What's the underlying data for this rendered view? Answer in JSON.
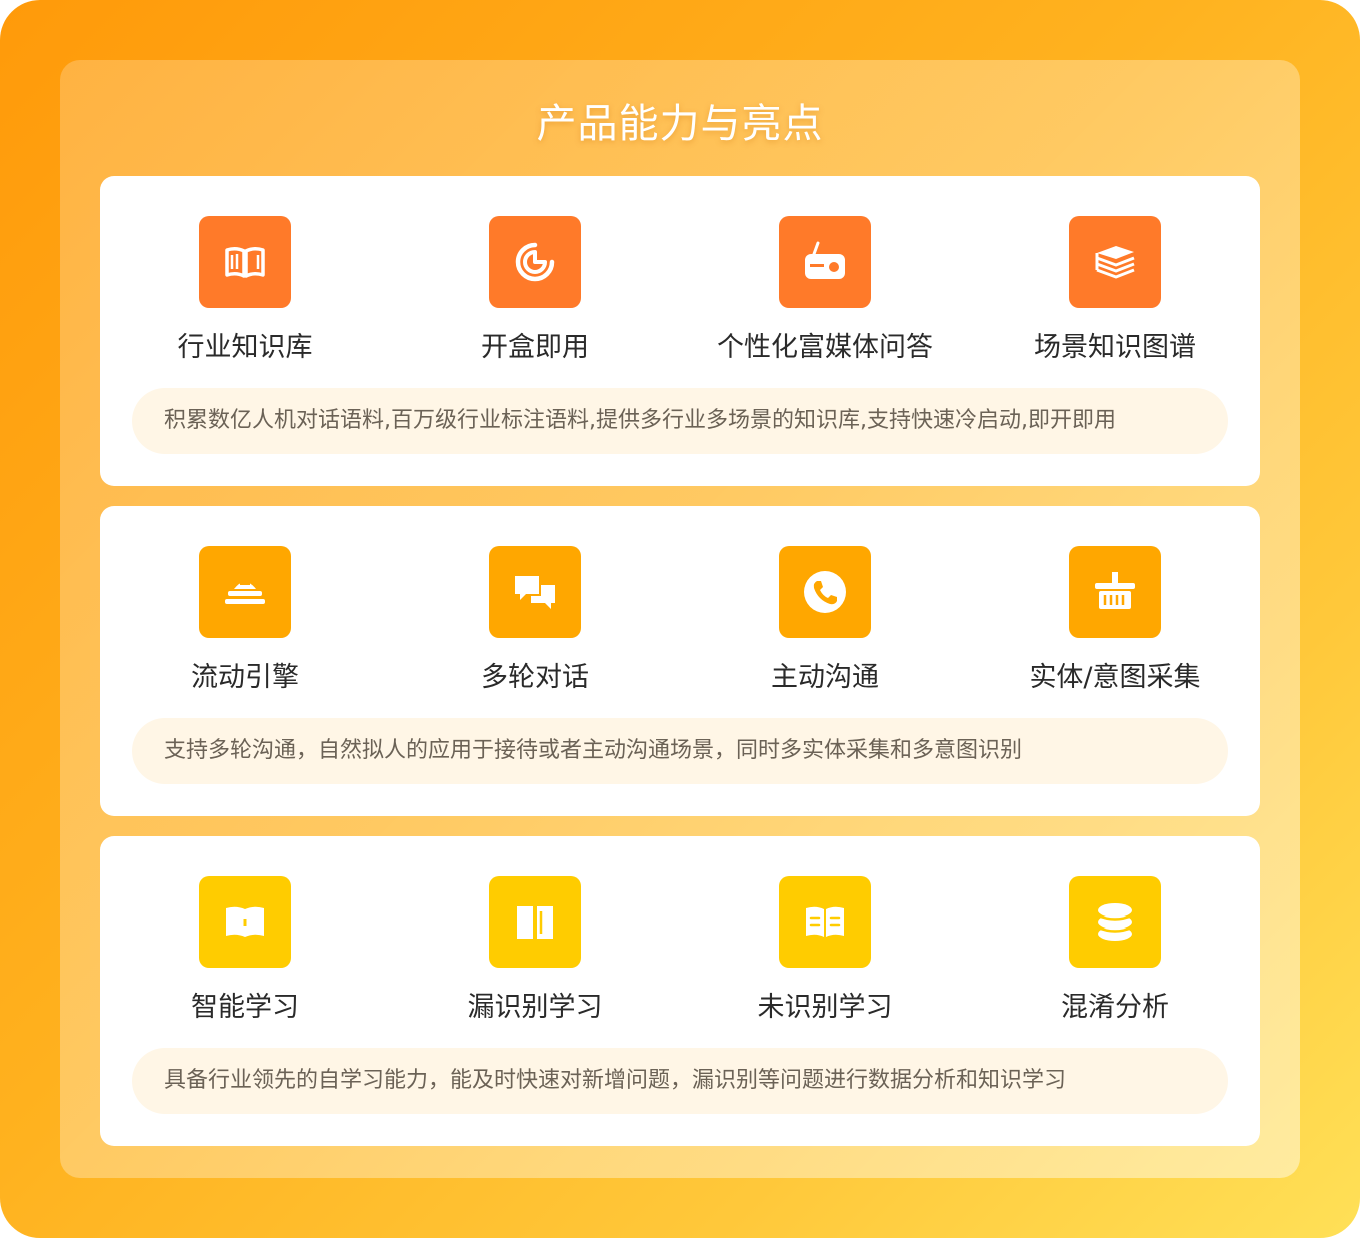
{
  "title": "产品能力与亮点",
  "colors": {
    "row1_icon": "#ff7a29",
    "row2_icon": "#ffa700",
    "row3_icon": "#ffcc00",
    "desc_bg": "#fff6e6"
  },
  "rows": [
    {
      "features": [
        {
          "label": "行业知识库",
          "icon": "open-book-icon"
        },
        {
          "label": "开盒即用",
          "icon": "pie-chart-icon"
        },
        {
          "label": "个性化富媒体问答",
          "icon": "radio-icon"
        },
        {
          "label": "场景知识图谱",
          "icon": "book-stack-icon"
        }
      ],
      "description": "积累数亿人机对话语料,百万级行业标注语料,提供多行业多场景的知识库,支持快速冷启动,即开即用"
    },
    {
      "features": [
        {
          "label": "流动引擎",
          "icon": "engine-icon"
        },
        {
          "label": "多轮对话",
          "icon": "chat-bubbles-icon"
        },
        {
          "label": "主动沟通",
          "icon": "phone-icon"
        },
        {
          "label": "实体/意图采集",
          "icon": "basket-icon"
        }
      ],
      "description": "支持多轮沟通，自然拟人的应用于接待或者主动沟通场景，同时多实体采集和多意图识别"
    },
    {
      "features": [
        {
          "label": "智能学习",
          "icon": "folded-book-icon"
        },
        {
          "label": "漏识别学习",
          "icon": "book-icon"
        },
        {
          "label": "未识别学习",
          "icon": "reading-book-icon"
        },
        {
          "label": "混淆分析",
          "icon": "database-icon"
        }
      ],
      "description": "具备行业领先的自学习能力，能及时快速对新增问题，漏识别等问题进行数据分析和知识学习"
    }
  ]
}
